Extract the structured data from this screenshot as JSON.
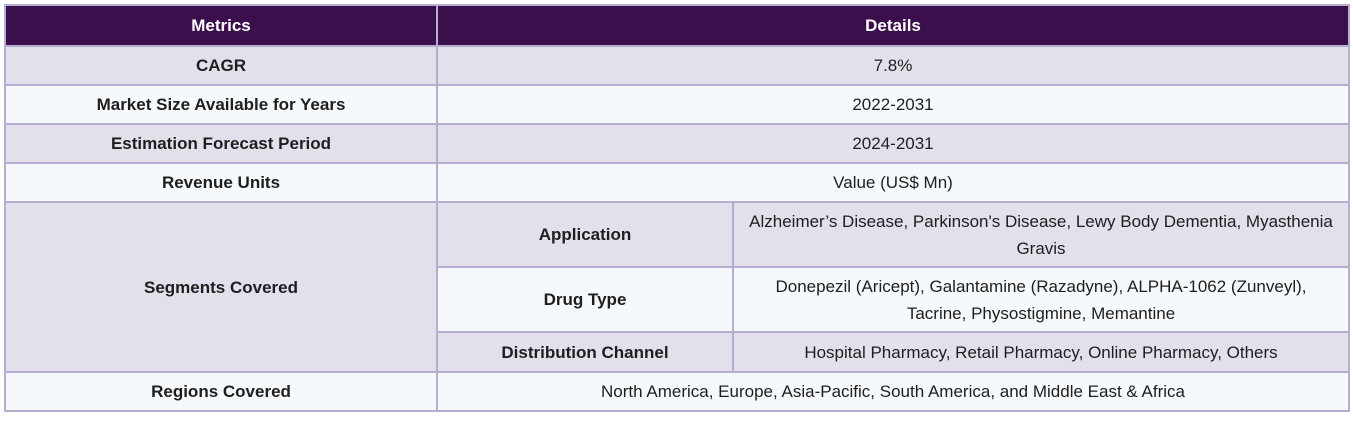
{
  "header": {
    "metrics_label": "Metrics",
    "details_label": "Details"
  },
  "rows": [
    {
      "metric": "CAGR",
      "detail": "7.8%"
    },
    {
      "metric": "Market Size Available for Years",
      "detail": "2022-2031"
    },
    {
      "metric": "Estimation Forecast Period",
      "detail": "2024-2031"
    },
    {
      "metric": "Revenue Units",
      "detail": "Value (US$ Mn)"
    }
  ],
  "segments": {
    "label": "Segments Covered",
    "items": [
      {
        "name": "Application",
        "value": "Alzheimer’s Disease, Parkinson's Disease, Lewy Body Dementia, Myasthenia Gravis"
      },
      {
        "name": "Drug Type",
        "value": "Donepezil (Aricept), Galantamine (Razadyne), ALPHA-1062 (Zunveyl), Tacrine, Physostigmine, Memantine"
      },
      {
        "name": "Distribution Channel",
        "value": "Hospital Pharmacy, Retail Pharmacy, Online Pharmacy, Others"
      }
    ]
  },
  "regions": {
    "label": "Regions Covered",
    "value": "North America, Europe, Asia-Pacific, South America, and Middle East & Africa"
  },
  "colors": {
    "header_bg": "#3a0f4c",
    "row_shade": "#e3dfeb",
    "row_plain": "#f5f9fc",
    "border": "#b6aed0"
  }
}
